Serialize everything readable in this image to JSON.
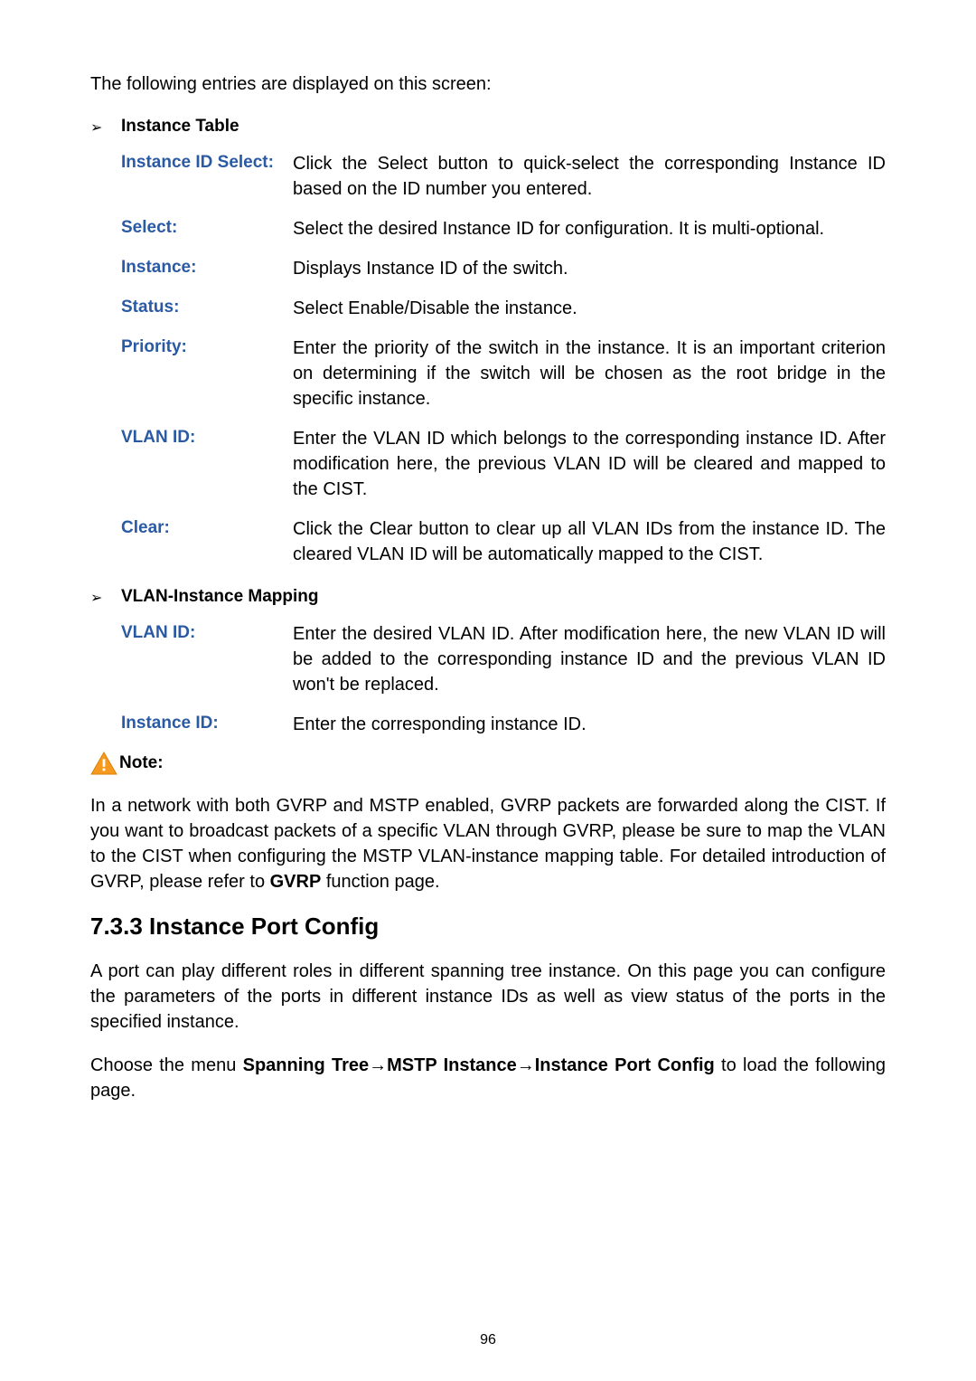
{
  "intro": "The following entries are displayed on this screen:",
  "section1": {
    "heading": "Instance Table",
    "rows": [
      {
        "term": "Instance ID Select:",
        "desc": "Click the Select button to quick-select the corresponding Instance ID based on the ID number you entered."
      },
      {
        "term": "Select:",
        "desc": "Select the desired Instance ID for configuration. It is multi-optional."
      },
      {
        "term": "Instance:",
        "desc": "Displays Instance ID of the switch."
      },
      {
        "term": "Status:",
        "desc": "Select Enable/Disable the instance."
      },
      {
        "term": "Priority:",
        "desc": "Enter the priority of the switch in the instance. It is an important criterion on determining if the switch will be chosen as the root bridge in the specific instance."
      },
      {
        "term": "VLAN ID:",
        "desc": "Enter the VLAN ID which belongs to the corresponding instance ID. After modification here, the previous VLAN ID will be cleared and mapped to the CIST."
      },
      {
        "term": "Clear:",
        "desc": "Click the Clear button to clear up all VLAN IDs from the instance ID. The cleared VLAN ID will be automatically mapped to the CIST."
      }
    ]
  },
  "section2": {
    "heading": "VLAN-Instance Mapping",
    "rows": [
      {
        "term": "VLAN ID:",
        "desc": "Enter the desired VLAN ID. After modification here, the new VLAN ID will be added to the corresponding instance ID and the previous VLAN ID won't be replaced."
      },
      {
        "term": "Instance ID:",
        "desc": "Enter the corresponding instance ID."
      }
    ]
  },
  "note": {
    "label": "Note:",
    "body_pre": "In a network with both GVRP and MSTP enabled, GVRP packets are forwarded along the CIST. If you want to broadcast packets of a specific VLAN through GVRP, please be sure to map the VLAN to the CIST when configuring the MSTP VLAN-instance mapping table. For detailed introduction of GVRP, please refer to ",
    "body_bold": "GVRP",
    "body_post": " function page."
  },
  "h3": "7.3.3 Instance Port Config",
  "p1": "A port can play different roles in different spanning tree instance. On this page you can configure the parameters of the ports in different instance IDs as well as view status of the ports in the specified instance.",
  "p2_pre": "Choose the menu ",
  "p2_bold": "Spanning Tree→MSTP Instance→Instance Port Config",
  "p2_post": " to load the following page.",
  "pagenum": "96"
}
